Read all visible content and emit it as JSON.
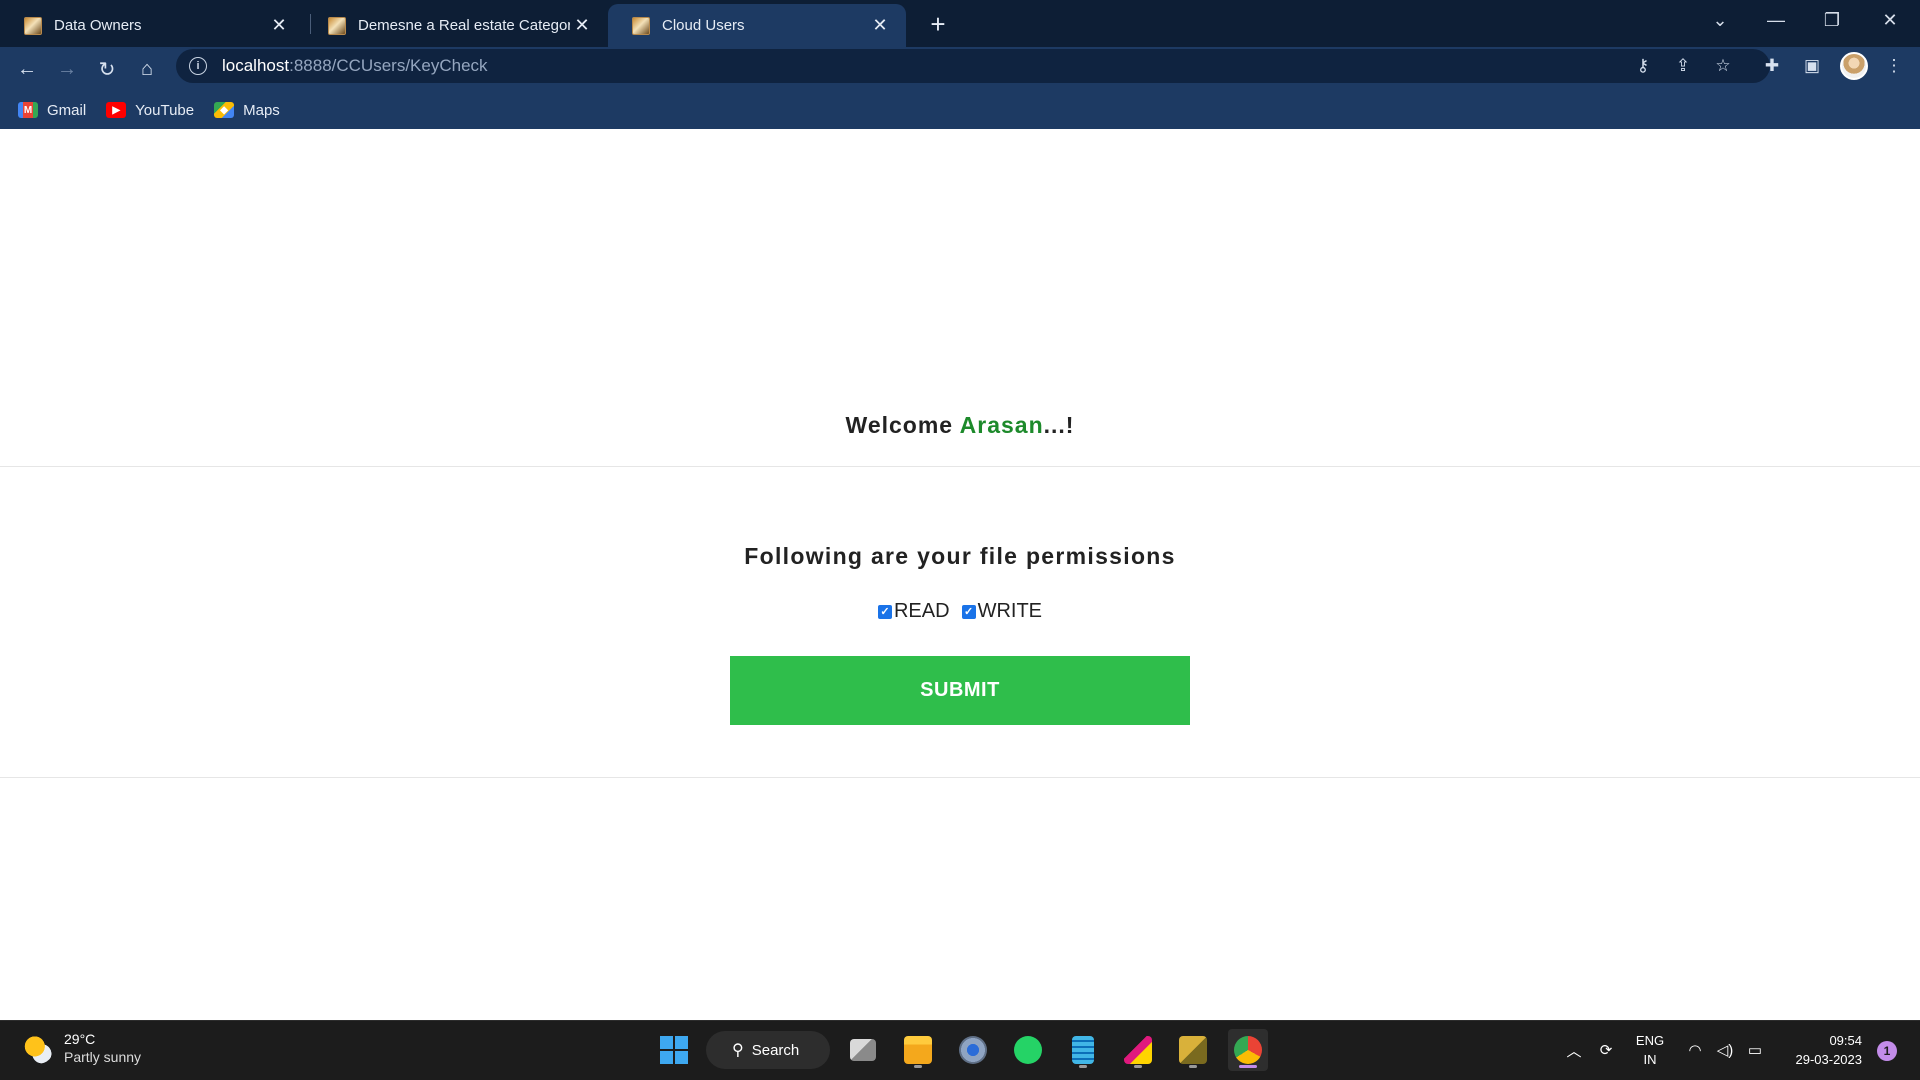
{
  "browser": {
    "tabs": [
      {
        "title": "Data Owners",
        "active": false
      },
      {
        "title": "Demesne a Real estate Category",
        "active": false
      },
      {
        "title": "Cloud Users",
        "active": true
      }
    ],
    "url": {
      "host": "localhost",
      "path": ":8888/CCUsers/KeyCheck"
    },
    "bookmarks": [
      {
        "label": "Gmail",
        "icon": "gmail-icon"
      },
      {
        "label": "YouTube",
        "icon": "youtube-icon"
      },
      {
        "label": "Maps",
        "icon": "maps-icon"
      }
    ]
  },
  "page": {
    "welcome_prefix": "Welcome ",
    "user_name": "Arasan",
    "welcome_suffix": "...!",
    "user_color": "#1d8a2b",
    "permissions_title": "Following are your file permissions",
    "permissions": [
      {
        "label": "READ",
        "checked": true
      },
      {
        "label": "WRITE",
        "checked": true
      }
    ],
    "submit_label": "SUBMIT",
    "submit_color": "#2fbe4b"
  },
  "taskbar": {
    "weather": {
      "temp": "29°C",
      "desc": "Partly sunny"
    },
    "search_label": "Search",
    "apps": [
      "task-view-icon",
      "file-explorer-icon",
      "settings-icon",
      "whatsapp-icon",
      "notepad-icon",
      "paint-icon",
      "db-tool-icon",
      "chrome-icon"
    ],
    "language": {
      "line1": "ENG",
      "line2": "IN"
    },
    "clock": {
      "time": "09:54",
      "date": "29-03-2023"
    },
    "notification_count": "1"
  }
}
